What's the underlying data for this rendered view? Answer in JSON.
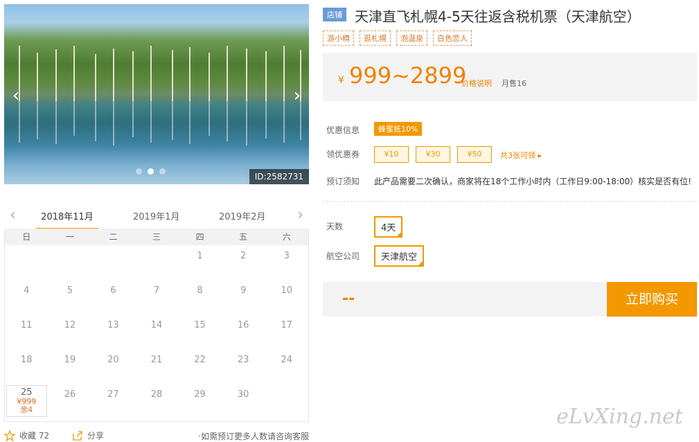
{
  "gallery": {
    "photo_id": "ID:2582731",
    "slide_count": 3,
    "active_slide": 2
  },
  "calendar": {
    "months": [
      "2018年11月",
      "2019年1月",
      "2019年2月"
    ],
    "active_month": "2018年11月",
    "weekdays": [
      "日",
      "一",
      "二",
      "三",
      "四",
      "五",
      "六"
    ],
    "days": [
      {
        "d": ""
      },
      {
        "d": ""
      },
      {
        "d": ""
      },
      {
        "d": ""
      },
      {
        "d": "1"
      },
      {
        "d": "2"
      },
      {
        "d": "3"
      },
      {
        "d": "4"
      },
      {
        "d": "5"
      },
      {
        "d": "6"
      },
      {
        "d": "7"
      },
      {
        "d": "8"
      },
      {
        "d": "9"
      },
      {
        "d": "10"
      },
      {
        "d": "11"
      },
      {
        "d": "12"
      },
      {
        "d": "13"
      },
      {
        "d": "14"
      },
      {
        "d": "15"
      },
      {
        "d": "16"
      },
      {
        "d": "17"
      },
      {
        "d": "18"
      },
      {
        "d": "19"
      },
      {
        "d": "20"
      },
      {
        "d": "21"
      },
      {
        "d": "22"
      },
      {
        "d": "23"
      },
      {
        "d": "24"
      },
      {
        "d": "25",
        "price": "¥999",
        "stock": "余4"
      },
      {
        "d": "26"
      },
      {
        "d": "27"
      },
      {
        "d": "28"
      },
      {
        "d": "29"
      },
      {
        "d": "30"
      },
      {
        "d": ""
      }
    ]
  },
  "bottom": {
    "favorite_label": "收藏 72",
    "share_label": "分享",
    "note": "·如需预订更多人数请咨询客服"
  },
  "product": {
    "shop_badge": "店铺",
    "title": "天津直飞札幌4-5天往返含税机票（天津航空）",
    "tags": [
      "游小樽",
      "逛札幌",
      "泡温泉",
      "白色恋人"
    ],
    "currency": "¥",
    "price": "999~2899",
    "price_note": "价格说明",
    "monthly_sales": "月售16"
  },
  "info": {
    "promo_label": "优惠信息",
    "promo_value": "蜂蜜抵10%",
    "coupon_label": "领优惠券",
    "coupons": [
      "¥10",
      "¥30",
      "¥50"
    ],
    "coupon_more": "共3张可领 ▸",
    "booking_label": "预订须知",
    "booking_text": "此产品需要二次确认，商家将在18个工作小时内（工作日9:00-18:00）核实是否有位!"
  },
  "options": {
    "days_label": "天数",
    "days_value": "4天",
    "airline_label": "航空公司",
    "airline_value": "天津航空"
  },
  "purchase": {
    "total_placeholder": "--",
    "buy_label": "立即购买"
  },
  "watermark": "eLvXing.net",
  "colors": {
    "accent": "#f39800",
    "price": "#f08200",
    "shop_badge": "#6c9bd6"
  }
}
